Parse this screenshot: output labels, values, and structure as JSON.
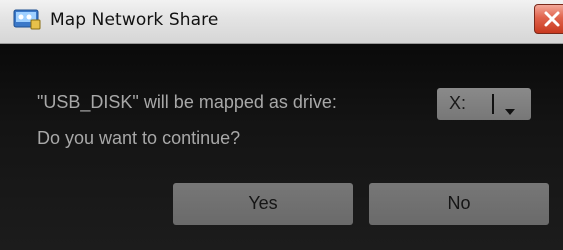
{
  "window": {
    "title": "Map Network Share"
  },
  "dialog": {
    "message_line1": "\"USB_DISK\" will be mapped as drive:",
    "message_line2": "Do you want to continue?",
    "drive_select": {
      "selected": "X:"
    },
    "buttons": {
      "yes_label": "Yes",
      "no_label": "No"
    }
  },
  "icons": {
    "app_icon": "network-drive-icon",
    "close_icon": "close-icon",
    "dropdown_arrow": "chevron-down-icon"
  },
  "colors": {
    "close_button": "#e0634c",
    "dialog_background": "#141414",
    "button_background": "#777777",
    "message_text": "#a8a8a8"
  }
}
